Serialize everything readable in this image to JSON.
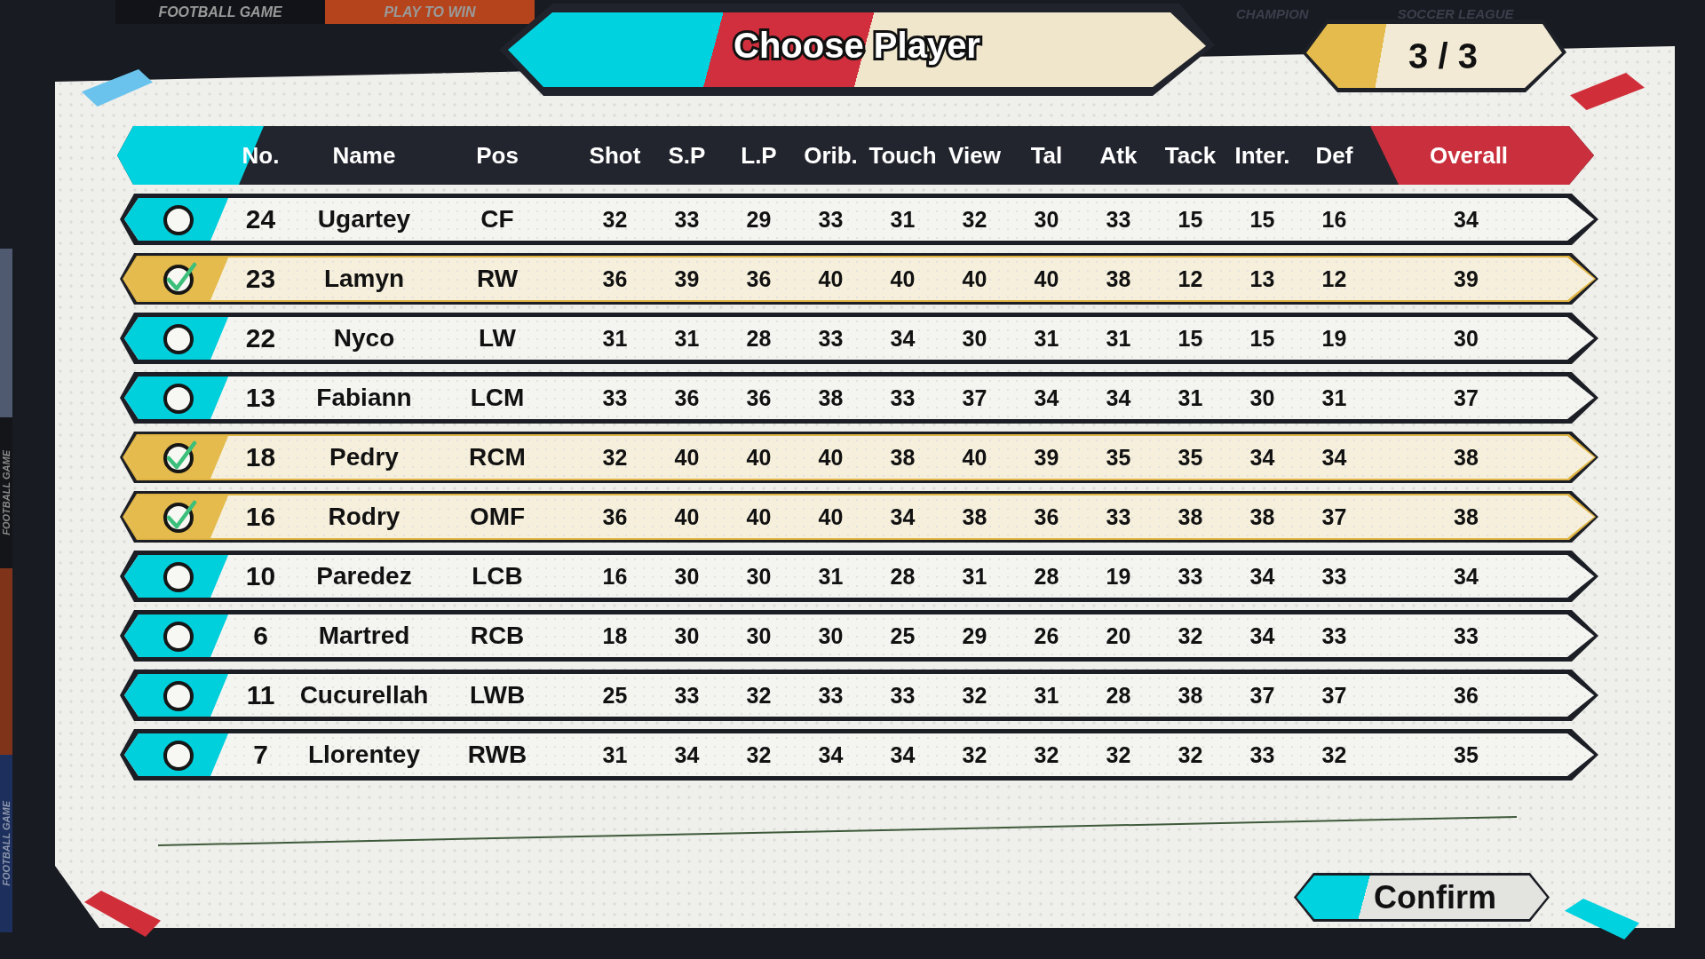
{
  "top_banners": [
    {
      "text": "FOOTBALL GAME",
      "color": "#121318"
    },
    {
      "text": "PLAY TO WIN",
      "color": "#b5441c"
    }
  ],
  "faint_labels": [
    "CHAMPION",
    "SOCCER LEAGUE"
  ],
  "side_labels": [
    {
      "text": "FOOTBALL GAME",
      "color": "#141519"
    },
    {
      "text": "FOOTBALL GAME",
      "color": "#1d2f5c"
    }
  ],
  "title": "Choose Player",
  "counter": "3 / 3",
  "table": {
    "columns": [
      "No.",
      "Name",
      "Pos",
      "Shot",
      "S.P",
      "L.P",
      "Orib.",
      "Touch",
      "View",
      "Tal",
      "Atk",
      "Tack",
      "Inter.",
      "Def",
      "Overall"
    ],
    "rows": [
      {
        "selected": false,
        "cells": [
          "24",
          "Ugartey",
          "CF",
          "32",
          "33",
          "29",
          "33",
          "31",
          "32",
          "30",
          "33",
          "15",
          "15",
          "16",
          "34"
        ]
      },
      {
        "selected": true,
        "cells": [
          "23",
          "Lamyn",
          "RW",
          "36",
          "39",
          "36",
          "40",
          "40",
          "40",
          "40",
          "38",
          "12",
          "13",
          "12",
          "39"
        ]
      },
      {
        "selected": false,
        "cells": [
          "22",
          "Nyco",
          "LW",
          "31",
          "31",
          "28",
          "33",
          "34",
          "30",
          "31",
          "31",
          "15",
          "15",
          "19",
          "30"
        ]
      },
      {
        "selected": false,
        "cells": [
          "13",
          "Fabiann",
          "LCM",
          "33",
          "36",
          "36",
          "38",
          "33",
          "37",
          "34",
          "34",
          "31",
          "30",
          "31",
          "37"
        ]
      },
      {
        "selected": true,
        "cells": [
          "18",
          "Pedry",
          "RCM",
          "32",
          "40",
          "40",
          "40",
          "38",
          "40",
          "39",
          "35",
          "35",
          "34",
          "34",
          "38"
        ]
      },
      {
        "selected": true,
        "cells": [
          "16",
          "Rodry",
          "OMF",
          "36",
          "40",
          "40",
          "40",
          "34",
          "38",
          "36",
          "33",
          "38",
          "38",
          "37",
          "38"
        ]
      },
      {
        "selected": false,
        "cells": [
          "10",
          "Paredez",
          "LCB",
          "16",
          "30",
          "30",
          "31",
          "28",
          "31",
          "28",
          "19",
          "33",
          "34",
          "33",
          "34"
        ]
      },
      {
        "selected": false,
        "cells": [
          "6",
          "Martred",
          "RCB",
          "18",
          "30",
          "30",
          "30",
          "25",
          "29",
          "26",
          "20",
          "32",
          "34",
          "33",
          "33"
        ]
      },
      {
        "selected": false,
        "cells": [
          "11",
          "Cucurellah",
          "LWB",
          "25",
          "33",
          "32",
          "33",
          "33",
          "32",
          "31",
          "28",
          "38",
          "37",
          "37",
          "36"
        ]
      },
      {
        "selected": false,
        "cells": [
          "7",
          "Llorentey",
          "RWB",
          "31",
          "34",
          "32",
          "34",
          "34",
          "32",
          "32",
          "32",
          "32",
          "33",
          "32",
          "35"
        ]
      }
    ]
  },
  "confirm_button": "Confirm"
}
